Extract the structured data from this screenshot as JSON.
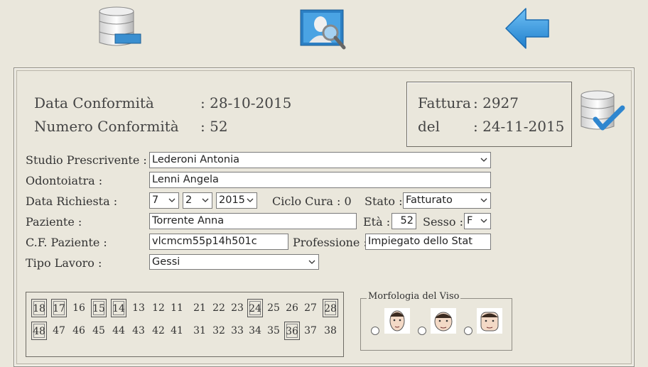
{
  "header": {
    "data_conformita_label": "Data Conformità",
    "data_conformita_value": ": 28-10-2015",
    "numero_conformita_label": "Numero Conformità",
    "numero_conformita_value": ": 52"
  },
  "fattura": {
    "label": "Fattura",
    "value": ": 2927",
    "del_label": "del",
    "del_value": ": 24-11-2015"
  },
  "form": {
    "studio_label": "Studio Prescrivente :",
    "studio_value": "Lederoni Antonia",
    "odontoiatra_label": "Odontoiatra :",
    "odontoiatra_value": "Lenni Angela",
    "data_richiesta_label": "Data Richiesta :",
    "day": "7",
    "month": "2",
    "year": "2015",
    "ciclo_cura": "Ciclo Cura : 0",
    "stato_label": "Stato :",
    "stato_value": "Fatturato",
    "paziente_label": "Paziente :",
    "paziente_value": "Torrente Anna",
    "eta_label": "Età :",
    "eta_value": "52",
    "sesso_label": "Sesso :",
    "sesso_value": "F",
    "cf_label": "C.F. Paziente :",
    "cf_value": "vlcmcm55p14h501c",
    "professione_label": "Professione :",
    "professione_value": "Impiegato dello Stat",
    "tipo_lavoro_label": "Tipo Lavoro :",
    "tipo_lavoro_value": "Gessi"
  },
  "teeth": {
    "top": [
      {
        "n": "18",
        "sel": true
      },
      {
        "n": "17",
        "sel": true
      },
      {
        "n": "16",
        "sel": false
      },
      {
        "n": "15",
        "sel": true
      },
      {
        "n": "14",
        "sel": true
      },
      {
        "n": "13",
        "sel": false
      },
      {
        "n": "12",
        "sel": false
      },
      {
        "n": "11",
        "sel": false
      },
      {
        "n": "21",
        "sel": false
      },
      {
        "n": "22",
        "sel": false
      },
      {
        "n": "23",
        "sel": false
      },
      {
        "n": "24",
        "sel": true
      },
      {
        "n": "25",
        "sel": false
      },
      {
        "n": "26",
        "sel": false
      },
      {
        "n": "27",
        "sel": false
      },
      {
        "n": "28",
        "sel": true
      }
    ],
    "bottom": [
      {
        "n": "48",
        "sel": true
      },
      {
        "n": "47",
        "sel": false
      },
      {
        "n": "46",
        "sel": false
      },
      {
        "n": "45",
        "sel": false
      },
      {
        "n": "44",
        "sel": false
      },
      {
        "n": "43",
        "sel": false
      },
      {
        "n": "42",
        "sel": false
      },
      {
        "n": "41",
        "sel": false
      },
      {
        "n": "31",
        "sel": false
      },
      {
        "n": "32",
        "sel": false
      },
      {
        "n": "33",
        "sel": false
      },
      {
        "n": "34",
        "sel": false
      },
      {
        "n": "35",
        "sel": false
      },
      {
        "n": "36",
        "sel": true
      },
      {
        "n": "37",
        "sel": false
      },
      {
        "n": "38",
        "sel": false
      }
    ]
  },
  "morfologia": {
    "legend": "Morfologia del Viso"
  },
  "icons": {
    "database": "database-minus-icon",
    "search": "patient-search-icon",
    "back": "back-arrow-icon",
    "confirm": "database-check-icon"
  },
  "colors": {
    "background": "#eae7dc",
    "accent_blue": "#2f8fd6"
  }
}
